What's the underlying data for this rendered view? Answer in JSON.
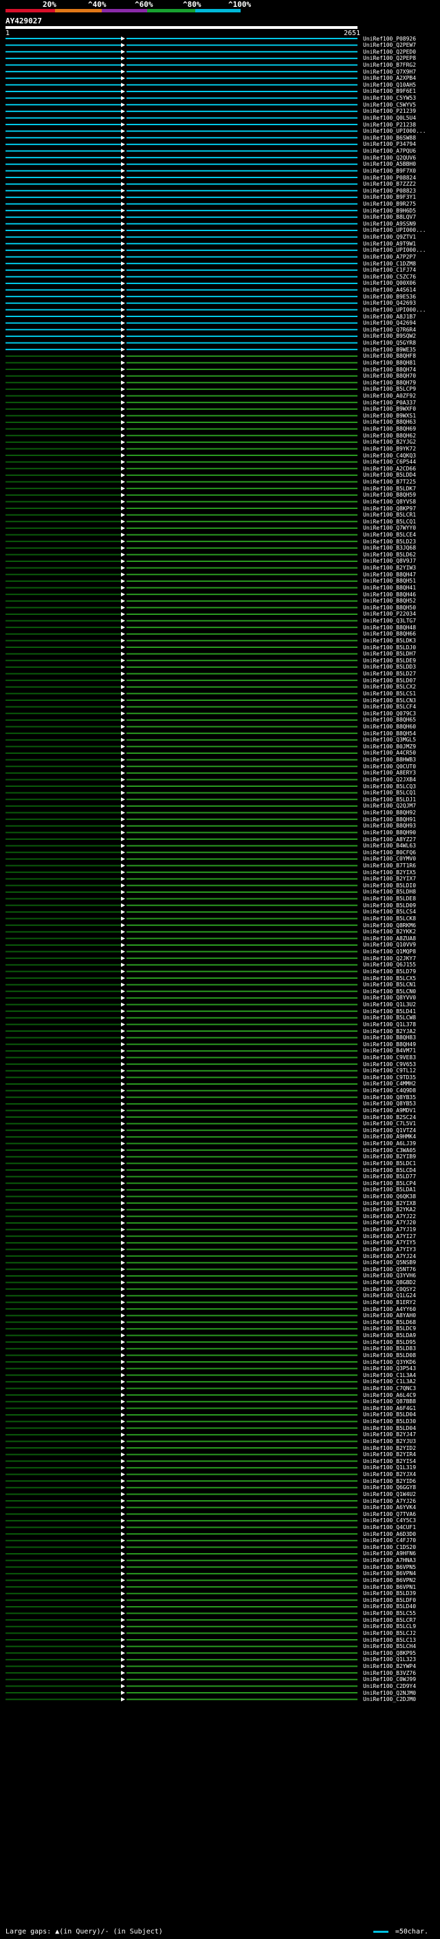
{
  "scale": {
    "labels": [
      "20%",
      "^40%",
      "^60%",
      "^80%",
      "^100%"
    ],
    "colors": [
      "#d8102a",
      "#e07818",
      "#8a2aa8",
      "#18a030",
      "#00b8d8"
    ]
  },
  "query": {
    "id": "AY429027",
    "start": "1",
    "end": "2651"
  },
  "colors": {
    "cyan": "#00c8e8",
    "green": "#2a9a20",
    "marker": "#ffffff"
  },
  "hits": [
    {
      "id": "UniRef100_P08926",
      "pct": 100
    },
    {
      "id": "UniRef100_Q2PEW7",
      "pct": 100
    },
    {
      "id": "UniRef100_Q2PED0",
      "pct": 100
    },
    {
      "id": "UniRef100_Q2PEP8",
      "pct": 100
    },
    {
      "id": "UniRef100_B7FRG2",
      "pct": 100
    },
    {
      "id": "UniRef100_Q7X9H7",
      "pct": 100
    },
    {
      "id": "UniRef100_A2XPB4",
      "pct": 100
    },
    {
      "id": "UniRef100_Q10AH5",
      "pct": 100
    },
    {
      "id": "UniRef100_B9F6E1",
      "pct": 100
    },
    {
      "id": "UniRef100_C5YW53",
      "pct": 100
    },
    {
      "id": "UniRef100_C5WYV5",
      "pct": 100
    },
    {
      "id": "UniRef100_P21239",
      "pct": 100
    },
    {
      "id": "UniRef100_Q0L5U4",
      "pct": 100
    },
    {
      "id": "UniRef100_P21238",
      "pct": 100
    },
    {
      "id": "UniRef100_UPI000...",
      "pct": 100
    },
    {
      "id": "UniRef100_B6SW88",
      "pct": 100
    },
    {
      "id": "UniRef100_P34794",
      "pct": 100
    },
    {
      "id": "UniRef100_A7PQU6",
      "pct": 100
    },
    {
      "id": "UniRef100_Q2QUV6",
      "pct": 100
    },
    {
      "id": "UniRef100_A5BBH0",
      "pct": 100
    },
    {
      "id": "UniRef100_B9F7X0",
      "pct": 100
    },
    {
      "id": "UniRef100_P08824",
      "pct": 100
    },
    {
      "id": "UniRef100_B7ZZZ2",
      "pct": 100
    },
    {
      "id": "UniRef100_P08823",
      "pct": 100
    },
    {
      "id": "UniRef100_B9F3Y1",
      "pct": 100
    },
    {
      "id": "UniRef100_B9R275",
      "pct": 100
    },
    {
      "id": "UniRef100_B9H6D5",
      "pct": 100
    },
    {
      "id": "UniRef100_B8LQV7",
      "pct": 100
    },
    {
      "id": "UniRef100_A9SSN9",
      "pct": 100
    },
    {
      "id": "UniRef100_UPI000...",
      "pct": 100
    },
    {
      "id": "UniRef100_Q9ZTV1",
      "pct": 100
    },
    {
      "id": "UniRef100_A9T9W1",
      "pct": 100
    },
    {
      "id": "UniRef100_UPI000...",
      "pct": 100
    },
    {
      "id": "UniRef100_A7P2P7",
      "pct": 100
    },
    {
      "id": "UniRef100_C1DZM8",
      "pct": 100
    },
    {
      "id": "UniRef100_C1FJ74",
      "pct": 100
    },
    {
      "id": "UniRef100_C5ZC76",
      "pct": 100
    },
    {
      "id": "UniRef100_Q00X06",
      "pct": 100
    },
    {
      "id": "UniRef100_A4S614",
      "pct": 100
    },
    {
      "id": "UniRef100_B9E536",
      "pct": 100
    },
    {
      "id": "UniRef100_Q42693",
      "pct": 100
    },
    {
      "id": "UniRef100_UPI000...",
      "pct": 100
    },
    {
      "id": "UniRef100_A8J1B7",
      "pct": 100
    },
    {
      "id": "UniRef100_Q42694",
      "pct": 100
    },
    {
      "id": "UniRef100_Q7R6R4",
      "pct": 100
    },
    {
      "id": "UniRef100_B9SQW2",
      "pct": 100
    },
    {
      "id": "UniRef100_Q5GYR8",
      "pct": 100
    },
    {
      "id": "UniRef100_B9WE35",
      "pct": 100
    },
    {
      "id": "UniRef100_B8QHF8",
      "pct": 80
    },
    {
      "id": "UniRef100_B8QH81",
      "pct": 80
    },
    {
      "id": "UniRef100_B8QH74",
      "pct": 80
    },
    {
      "id": "UniRef100_B8QH70",
      "pct": 80
    },
    {
      "id": "UniRef100_B8QH79",
      "pct": 80
    },
    {
      "id": "UniRef100_B5LCP9",
      "pct": 80
    },
    {
      "id": "UniRef100_A0ZF92",
      "pct": 80
    },
    {
      "id": "UniRef100_P0A337",
      "pct": 80
    },
    {
      "id": "UniRef100_B9WXF0",
      "pct": 80
    },
    {
      "id": "UniRef100_B9WXS1",
      "pct": 80
    },
    {
      "id": "UniRef100_B8QH63",
      "pct": 80
    },
    {
      "id": "UniRef100_B8QH69",
      "pct": 80
    },
    {
      "id": "UniRef100_B8QH62",
      "pct": 80
    },
    {
      "id": "UniRef100_B2YJG2",
      "pct": 80
    },
    {
      "id": "UniRef100_B9YK72",
      "pct": 80
    },
    {
      "id": "UniRef100_C4QKQ3",
      "pct": 80
    },
    {
      "id": "UniRef100_C6P544",
      "pct": 80
    },
    {
      "id": "UniRef100_A2CD66",
      "pct": 80
    },
    {
      "id": "UniRef100_B5LDD4",
      "pct": 80
    },
    {
      "id": "UniRef100_B7T225",
      "pct": 80
    },
    {
      "id": "UniRef100_B5LDK7",
      "pct": 80
    },
    {
      "id": "UniRef100_B8QH59",
      "pct": 80
    },
    {
      "id": "UniRef100_Q8YVS8",
      "pct": 80
    },
    {
      "id": "UniRef100_Q8KP97",
      "pct": 80
    },
    {
      "id": "UniRef100_B5LCR1",
      "pct": 80
    },
    {
      "id": "UniRef100_B5LCQ1",
      "pct": 80
    },
    {
      "id": "UniRef100_Q7WYY0",
      "pct": 80
    },
    {
      "id": "UniRef100_B5LCE4",
      "pct": 80
    },
    {
      "id": "UniRef100_B5LD23",
      "pct": 80
    },
    {
      "id": "UniRef100_B3JQ68",
      "pct": 80
    },
    {
      "id": "UniRef100_B5LD62",
      "pct": 80
    },
    {
      "id": "UniRef100_Q8V9J7",
      "pct": 80
    },
    {
      "id": "UniRef100_B2YIW3",
      "pct": 80
    },
    {
      "id": "UniRef100_B8QH47",
      "pct": 80
    },
    {
      "id": "UniRef100_B8QH51",
      "pct": 80
    },
    {
      "id": "UniRef100_B8QH41",
      "pct": 80
    },
    {
      "id": "UniRef100_B8QH46",
      "pct": 80
    },
    {
      "id": "UniRef100_B8QH52",
      "pct": 80
    },
    {
      "id": "UniRef100_B8QH50",
      "pct": 80
    },
    {
      "id": "UniRef100_P22034",
      "pct": 80
    },
    {
      "id": "UniRef100_Q3LTG7",
      "pct": 80
    },
    {
      "id": "UniRef100_B8QH48",
      "pct": 80
    },
    {
      "id": "UniRef100_B8QH66",
      "pct": 80
    },
    {
      "id": "UniRef100_B5LDK3",
      "pct": 80
    },
    {
      "id": "UniRef100_B5LDJ0",
      "pct": 80
    },
    {
      "id": "UniRef100_B5LDH7",
      "pct": 80
    },
    {
      "id": "UniRef100_B5LDE9",
      "pct": 80
    },
    {
      "id": "UniRef100_B5LDD3",
      "pct": 80
    },
    {
      "id": "UniRef100_B5LD27",
      "pct": 80
    },
    {
      "id": "UniRef100_B5LD07",
      "pct": 80
    },
    {
      "id": "UniRef100_B5LCX2",
      "pct": 80
    },
    {
      "id": "UniRef100_B5LCS1",
      "pct": 80
    },
    {
      "id": "UniRef100_B5LCN3",
      "pct": 80
    },
    {
      "id": "UniRef100_B5LCF4",
      "pct": 80
    },
    {
      "id": "UniRef100_Q079C3",
      "pct": 80
    },
    {
      "id": "UniRef100_B8QH65",
      "pct": 80
    },
    {
      "id": "UniRef100_B8QH60",
      "pct": 80
    },
    {
      "id": "UniRef100_B8QH54",
      "pct": 80
    },
    {
      "id": "UniRef100_Q3MGL5",
      "pct": 80
    },
    {
      "id": "UniRef100_B0JMZ9",
      "pct": 80
    },
    {
      "id": "UniRef100_A4CR50",
      "pct": 80
    },
    {
      "id": "UniRef100_B8HWB3",
      "pct": 80
    },
    {
      "id": "UniRef100_Q0CUT0",
      "pct": 80
    },
    {
      "id": "UniRef100_A8ERY3",
      "pct": 80
    },
    {
      "id": "UniRef100_Q2JXB4",
      "pct": 80
    },
    {
      "id": "UniRef100_B5LCQ3",
      "pct": 80
    },
    {
      "id": "UniRef100_B5LCQ1",
      "pct": 80
    },
    {
      "id": "UniRef100_B5LDJ1",
      "pct": 80
    },
    {
      "id": "UniRef100_Q2QJM7",
      "pct": 80
    },
    {
      "id": "UniRef100_B8QH92",
      "pct": 80
    },
    {
      "id": "UniRef100_B8QH91",
      "pct": 80
    },
    {
      "id": "UniRef100_B8QH93",
      "pct": 80
    },
    {
      "id": "UniRef100_B8QH90",
      "pct": 80
    },
    {
      "id": "UniRef100_A8YZ27",
      "pct": 80
    },
    {
      "id": "UniRef100_B4WL63",
      "pct": 80
    },
    {
      "id": "UniRef100_B0CFQ6",
      "pct": 80
    },
    {
      "id": "UniRef100_C0YMV0",
      "pct": 80
    },
    {
      "id": "UniRef100_B7T1R6",
      "pct": 80
    },
    {
      "id": "UniRef100_B2YIX5",
      "pct": 80
    },
    {
      "id": "UniRef100_B2YIX7",
      "pct": 80
    },
    {
      "id": "UniRef100_B5LDI0",
      "pct": 80
    },
    {
      "id": "UniRef100_B5LDH8",
      "pct": 80
    },
    {
      "id": "UniRef100_B5LDE8",
      "pct": 80
    },
    {
      "id": "UniRef100_B5LD09",
      "pct": 80
    },
    {
      "id": "UniRef100_B5LCS4",
      "pct": 80
    },
    {
      "id": "UniRef100_B5LCK8",
      "pct": 80
    },
    {
      "id": "UniRef100_Q8RKM6",
      "pct": 80
    },
    {
      "id": "UniRef100_B2YKK2",
      "pct": 80
    },
    {
      "id": "UniRef100_A8ZUA8",
      "pct": 80
    },
    {
      "id": "UniRef100_Q10VV9",
      "pct": 80
    },
    {
      "id": "UniRef100_Q1MQP8",
      "pct": 80
    },
    {
      "id": "UniRef100_Q2JKY7",
      "pct": 80
    },
    {
      "id": "UniRef100_Q6J155",
      "pct": 80
    },
    {
      "id": "UniRef100_B5LD79",
      "pct": 80
    },
    {
      "id": "UniRef100_B5LCX5",
      "pct": 80
    },
    {
      "id": "UniRef100_B5LCN1",
      "pct": 80
    },
    {
      "id": "UniRef100_B5LCN0",
      "pct": 80
    },
    {
      "id": "UniRef100_Q8YVV0",
      "pct": 80
    },
    {
      "id": "UniRef100_Q1L3U2",
      "pct": 80
    },
    {
      "id": "UniRef100_B5LD41",
      "pct": 80
    },
    {
      "id": "UniRef100_B5LCW8",
      "pct": 80
    },
    {
      "id": "UniRef100_Q1L378",
      "pct": 80
    },
    {
      "id": "UniRef100_B2YJA2",
      "pct": 80
    },
    {
      "id": "UniRef100_B8QH83",
      "pct": 80
    },
    {
      "id": "UniRef100_B8QH49",
      "pct": 80
    },
    {
      "id": "UniRef100_B4VM71",
      "pct": 80
    },
    {
      "id": "UniRef100_C9VE83",
      "pct": 80
    },
    {
      "id": "UniRef100_C9V653",
      "pct": 80
    },
    {
      "id": "UniRef100_C9TL12",
      "pct": 80
    },
    {
      "id": "UniRef100_C9TD35",
      "pct": 80
    },
    {
      "id": "UniRef100_C4MMH2",
      "pct": 80
    },
    {
      "id": "UniRef100_C4Q9D8",
      "pct": 80
    },
    {
      "id": "UniRef100_Q8YB35",
      "pct": 80
    },
    {
      "id": "UniRef100_Q8YB53",
      "pct": 80
    },
    {
      "id": "UniRef100_A9MDV1",
      "pct": 80
    },
    {
      "id": "UniRef100_B2SC24",
      "pct": 80
    },
    {
      "id": "UniRef100_C7L5V1",
      "pct": 80
    },
    {
      "id": "UniRef100_Q1VTZ4",
      "pct": 80
    },
    {
      "id": "UniRef100_A9HMK4",
      "pct": 80
    },
    {
      "id": "UniRef100_A6LJ39",
      "pct": 80
    },
    {
      "id": "UniRef100_C3WA05",
      "pct": 80
    },
    {
      "id": "UniRef100_B2YIB9",
      "pct": 80
    },
    {
      "id": "UniRef100_B5LDC1",
      "pct": 80
    },
    {
      "id": "UniRef100_B5LCD4",
      "pct": 80
    },
    {
      "id": "UniRef100_B5LD77",
      "pct": 80
    },
    {
      "id": "UniRef100_B5LCP4",
      "pct": 80
    },
    {
      "id": "UniRef100_B5LDA1",
      "pct": 80
    },
    {
      "id": "UniRef100_Q6QK38",
      "pct": 80
    },
    {
      "id": "UniRef100_B2YIX8",
      "pct": 80
    },
    {
      "id": "UniRef100_B2YKA2",
      "pct": 80
    },
    {
      "id": "UniRef100_A7YJ22",
      "pct": 80
    },
    {
      "id": "UniRef100_A7YJ20",
      "pct": 80
    },
    {
      "id": "UniRef100_A7YJ19",
      "pct": 80
    },
    {
      "id": "UniRef100_A7YI27",
      "pct": 80
    },
    {
      "id": "UniRef100_A7YIY5",
      "pct": 80
    },
    {
      "id": "UniRef100_A7YIY3",
      "pct": 80
    },
    {
      "id": "UniRef100_A7YJ24",
      "pct": 80
    },
    {
      "id": "UniRef100_Q5NSB9",
      "pct": 80
    },
    {
      "id": "UniRef100_Q5NT76",
      "pct": 80
    },
    {
      "id": "UniRef100_Q3YVH6",
      "pct": 80
    },
    {
      "id": "UniRef100_Q8GBD2",
      "pct": 80
    },
    {
      "id": "UniRef100_C0QSY2",
      "pct": 80
    },
    {
      "id": "UniRef100_Q1LG24",
      "pct": 80
    },
    {
      "id": "UniRef100_B1ERY2",
      "pct": 80
    },
    {
      "id": "UniRef100_A4YY60",
      "pct": 80
    },
    {
      "id": "UniRef100_A8YAH0",
      "pct": 80
    },
    {
      "id": "UniRef100_B5LD68",
      "pct": 80
    },
    {
      "id": "UniRef100_B5LDC9",
      "pct": 80
    },
    {
      "id": "UniRef100_B5LDA9",
      "pct": 80
    },
    {
      "id": "UniRef100_B5LD95",
      "pct": 80
    },
    {
      "id": "UniRef100_B5LD83",
      "pct": 80
    },
    {
      "id": "UniRef100_B5LD08",
      "pct": 80
    },
    {
      "id": "UniRef100_Q3YKD6",
      "pct": 80
    },
    {
      "id": "UniRef100_Q3P543",
      "pct": 80
    },
    {
      "id": "UniRef100_C1L3A4",
      "pct": 80
    },
    {
      "id": "UniRef100_C1L3A2",
      "pct": 80
    },
    {
      "id": "UniRef100_C7QNC3",
      "pct": 80
    },
    {
      "id": "UniRef100_A6L4C9",
      "pct": 80
    },
    {
      "id": "UniRef100_Q87BB8",
      "pct": 80
    },
    {
      "id": "UniRef100_A6F4G1",
      "pct": 80
    },
    {
      "id": "UniRef100_B5LD04",
      "pct": 80
    },
    {
      "id": "UniRef100_B5LD30",
      "pct": 80
    },
    {
      "id": "UniRef100_B5LD04",
      "pct": 80
    },
    {
      "id": "UniRef100_B2YJ47",
      "pct": 80
    },
    {
      "id": "UniRef100_B2YJU3",
      "pct": 80
    },
    {
      "id": "UniRef100_B2YID2",
      "pct": 80
    },
    {
      "id": "UniRef100_B2YIR4",
      "pct": 80
    },
    {
      "id": "UniRef100_B2YIS4",
      "pct": 80
    },
    {
      "id": "UniRef100_Q1L319",
      "pct": 80
    },
    {
      "id": "UniRef100_B2YJX4",
      "pct": 80
    },
    {
      "id": "UniRef100_B2YID6",
      "pct": 80
    },
    {
      "id": "UniRef100_Q6GGY8",
      "pct": 80
    },
    {
      "id": "UniRef100_Q1W4U2",
      "pct": 80
    },
    {
      "id": "UniRef100_A7YJ26",
      "pct": 80
    },
    {
      "id": "UniRef100_A6YVK4",
      "pct": 80
    },
    {
      "id": "UniRef100_Q7TVA6",
      "pct": 80
    },
    {
      "id": "UniRef100_C4Y5C3",
      "pct": 80
    },
    {
      "id": "UniRef100_Q4CUF1",
      "pct": 80
    },
    {
      "id": "UniRef100_A6D3D0",
      "pct": 80
    },
    {
      "id": "UniRef100_C4FJ70",
      "pct": 80
    },
    {
      "id": "UniRef100_C1DS20",
      "pct": 80
    },
    {
      "id": "UniRef100_A9HFN6",
      "pct": 80
    },
    {
      "id": "UniRef100_A7HNA3",
      "pct": 80
    },
    {
      "id": "UniRef100_B6VPN5",
      "pct": 80
    },
    {
      "id": "UniRef100_B6VPN4",
      "pct": 80
    },
    {
      "id": "UniRef100_B6VPN2",
      "pct": 80
    },
    {
      "id": "UniRef100_B6VPN1",
      "pct": 80
    },
    {
      "id": "UniRef100_B5LD39",
      "pct": 80
    },
    {
      "id": "UniRef100_B5LDF0",
      "pct": 80
    },
    {
      "id": "UniRef100_B5LD40",
      "pct": 80
    },
    {
      "id": "UniRef100_B5LC55",
      "pct": 80
    },
    {
      "id": "UniRef100_B5LCR7",
      "pct": 80
    },
    {
      "id": "UniRef100_B5LCL9",
      "pct": 80
    },
    {
      "id": "UniRef100_B5LCJ2",
      "pct": 80
    },
    {
      "id": "UniRef100_B5LC13",
      "pct": 80
    },
    {
      "id": "UniRef100_B5LCH4",
      "pct": 80
    },
    {
      "id": "UniRef100_Q8KP95",
      "pct": 80
    },
    {
      "id": "UniRef100_Q1L323",
      "pct": 80
    },
    {
      "id": "UniRef100_B2YWP4",
      "pct": 80
    },
    {
      "id": "UniRef100_B3VZ76",
      "pct": 80
    },
    {
      "id": "UniRef100_C0WJ99",
      "pct": 80
    },
    {
      "id": "UniRef100_C2D9Y4",
      "pct": 80
    },
    {
      "id": "UniRef100_Q2NJM0",
      "pct": 80
    },
    {
      "id": "UniRef100_C2DJM0",
      "pct": 80
    }
  ],
  "footer": {
    "text": "Large gaps: ▲(in Query)/- (in Subject)",
    "legend": "=50char."
  }
}
